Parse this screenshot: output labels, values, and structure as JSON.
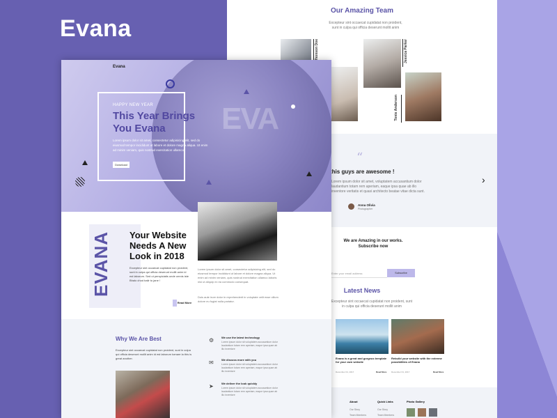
{
  "brand": "Evana",
  "colors": {
    "accent": "#5b54a7",
    "bg": "#6760b1",
    "light": "#a9a4e6"
  },
  "back": {
    "team_title": "Our Amazing Team",
    "team_sub": "Excepteur sint occaecat cupidatat non proident, sunt in culpa qui officia deserunt mollit anim",
    "members": [
      {
        "name": "Jhonson Doe",
        "role": "Developer"
      },
      {
        "name": "Jessica Parker",
        "role": "Developer"
      },
      {
        "name": "Tonie Anderson",
        "role": "Designer"
      }
    ],
    "testimonial": {
      "quote": "this guys are awesome !",
      "body": "Lorem ipsum dolor sit amet, voluptatem accusantium dolor laudantium totam rem aperiam, eaque ipsa quae ab illo inventore veritatis et quasi architecto beatae vitae dicta sunt.",
      "author": "Anna Olivia",
      "author_role": "Photographer"
    },
    "subscribe": {
      "title": "We are Amazing in our works. Subscribe now",
      "placeholder": "Enter your email address",
      "button": "Subscribe"
    },
    "news": {
      "title": "Latest News",
      "sub": "Excepteur sint occaecat cupidatat non proident, sunt in culpa qui officia deserunt mollit anim",
      "items": [
        {
          "title": "Evana is a great and gorgeus template for your own website",
          "date": "December 01, 2017",
          "more": "Read More"
        },
        {
          "title": "Rebuild your website with the extreme possibilities of Evana",
          "date": "December 01, 2017",
          "more": "Read More"
        }
      ]
    },
    "footer": {
      "about": "About",
      "quick": "Quick Links",
      "gallery": "Photo Gallery",
      "about_items": [
        "Our Story",
        "Team Members"
      ],
      "quick_items": [
        "Our Story",
        "Team Members"
      ]
    }
  },
  "front": {
    "logo": "Evana",
    "hero": {
      "kicker": "HAPPY NEW YEAR",
      "title1": "This Year Brings",
      "title2": "You Evana",
      "body": "Lorem ipsum dolor sit amet, consectetur adipisicing elit, sed do eiusmod tempor incididunt ut labore et dolore magna aliqua. Ut enim ad minim veniam, quis nostrud exercitation ullamco",
      "button": "Download"
    },
    "about": {
      "vertical": "EVANA",
      "title1": "Your Website",
      "title2": "Needs A New",
      "title3": "Look in 2018",
      "body": "Excepteur sint occaecat cupidatat non proident, sunt in culpa qui officia deserunt mollit anim id est laborum. Sed ut perspiciatis unde omnis iste Bhalo chod balir tu jane !",
      "body2": "Lorem ipsum dolor sit amet, consectetur adipisicing elit, sed do eiusmod tempor incididunt ut labore et dolore magna aliqua. Ut enim ad minim veniam, quis nostrud exercitation ullamco laboris nisi ut aliquip ex ea commodo consequat.",
      "body3": "Duis aute irure dolor in reprehenderit in voluptate velit esse cillum dolore eu fugiat nulla pariatur.",
      "more": "Read More"
    },
    "why": {
      "title": "Why We Are Best",
      "body": "Excepteur sint occaecat cupidatat non proident, sunt in culpa qui officia deserunt mollit anim id est laborum tomare la this is great another.",
      "features": [
        {
          "title": "We use the latest technology",
          "text": "Lorem ipsum dolor sit voluptatem accusantium dolor laudantium totam rem aperiam, eaque ipsa quae ab illo inventore"
        },
        {
          "title": "We discuss more with you",
          "text": "Lorem ipsum dolor sit voluptatem accusantium dolor laudantium totam rem aperiam, eaque ipsa quae ab illo inventore"
        },
        {
          "title": "We deliver the look quickly",
          "text": "Lorem ipsum dolor sit voluptatem accusantium dolor laudantium totam rem aperiam, eaque ipsa quae ab illo inventore"
        }
      ]
    }
  }
}
